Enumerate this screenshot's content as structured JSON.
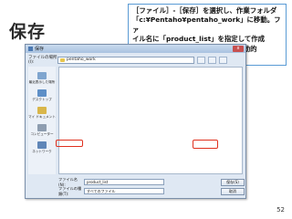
{
  "slide": {
    "title": "保存",
    "instruction": "［ファイル］-［保存］を選択し、作業フォルダ\n「c:¥Pentaho¥pentaho_work」に移動。ファ\nイル名に「product_list」を指定して作成\nしたレポートを保存。（※拡張子は自動的\nに「prpt」が指定される）",
    "page_number": "52"
  },
  "dialog": {
    "title": "保存",
    "close": "x",
    "location_label": "ファイルの場所(I):",
    "location_value": "pentaho_work",
    "places": [
      {
        "label": "最近表示した場所"
      },
      {
        "label": "デスクトップ"
      },
      {
        "label": "マイ ドキュメント"
      },
      {
        "label": "コンピューター"
      },
      {
        "label": "ネットワーク"
      }
    ],
    "filename_label": "ファイル名(N):",
    "filename_value": "product_list",
    "filetype_label": "ファイルの種類(T):",
    "filetype_value": "すべてのファイル",
    "save_button": "保存(S)",
    "cancel_button": "取消"
  },
  "colors": {
    "highlight": "#e0301e",
    "callout_border": "#5a9bd5"
  }
}
